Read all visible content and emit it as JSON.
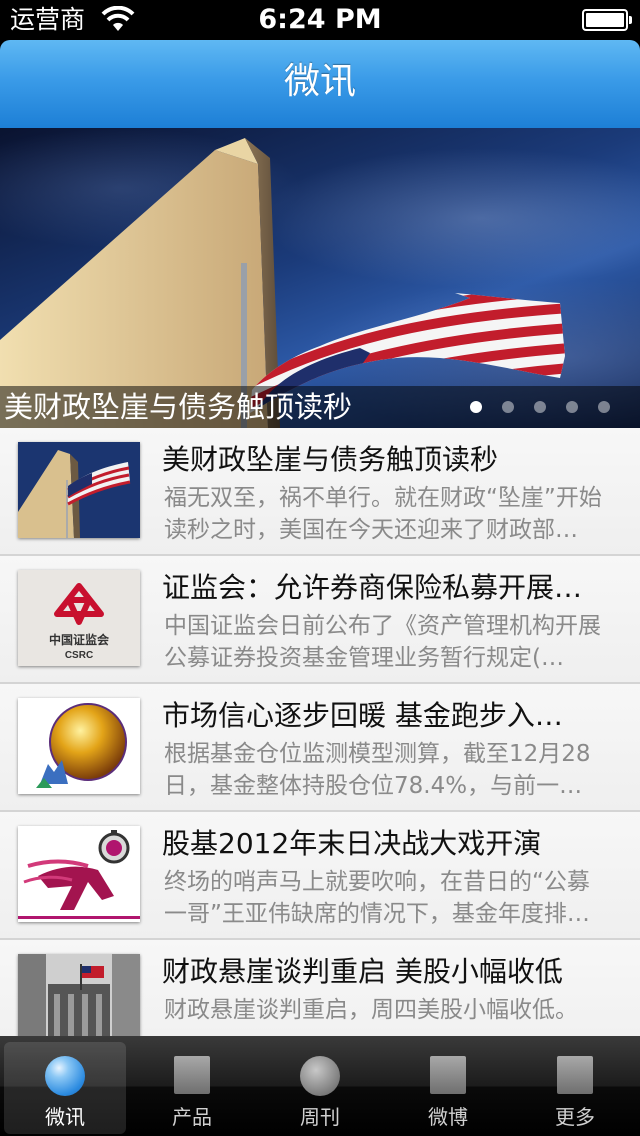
{
  "status_bar": {
    "carrier": "运营商",
    "time": "6:24 PM"
  },
  "nav": {
    "title": "微讯"
  },
  "banner": {
    "caption": "美财政坠崖与债务触顶读秒",
    "page_count": 5,
    "active_page": 0
  },
  "news": [
    {
      "title": "美财政坠崖与债务触顶读秒",
      "summary": "福无双至，祸不单行。就在财政“坠崖”开始读秒之时，美国在今天还迎来了财政部…",
      "thumb": "monument-flag"
    },
    {
      "title": "证监会：允许券商保险私募开展…",
      "summary": "中国证监会日前公布了《资产管理机构开展公募证券投资基金管理业务暂行规定(…",
      "thumb": "csrc-logo",
      "thumb_text": [
        "中国证监会",
        "CSRC"
      ]
    },
    {
      "title": "市场信心逐步回暖 基金跑步入…",
      "summary": "根据基金仓位监测模型测算，截至12月28日，基金整体持股仓位78.4%，与前一…",
      "thumb": "golden-globe"
    },
    {
      "title": "股基2012年末日决战大戏开演",
      "summary": "终场的哨声马上就要吹响，在昔日的“公募一哥”王亚伟缺席的情况下，基金年度排…",
      "thumb": "runner-stopwatch"
    },
    {
      "title": "财政悬崖谈判重启 美股小幅收低",
      "summary": "财政悬崖谈判重启，周四美股小幅收低。",
      "thumb": "wall-street"
    }
  ],
  "tabs": [
    {
      "label": "微讯",
      "icon": "globe-icon",
      "active": true
    },
    {
      "label": "产品",
      "icon": "square-icon",
      "active": false
    },
    {
      "label": "周刊",
      "icon": "circle-icon",
      "active": false
    },
    {
      "label": "微博",
      "icon": "square-icon",
      "active": false
    },
    {
      "label": "更多",
      "icon": "square-icon",
      "active": false
    }
  ],
  "colors": {
    "nav_blue": "#3a9be8",
    "csrc_red": "#c8102e"
  }
}
